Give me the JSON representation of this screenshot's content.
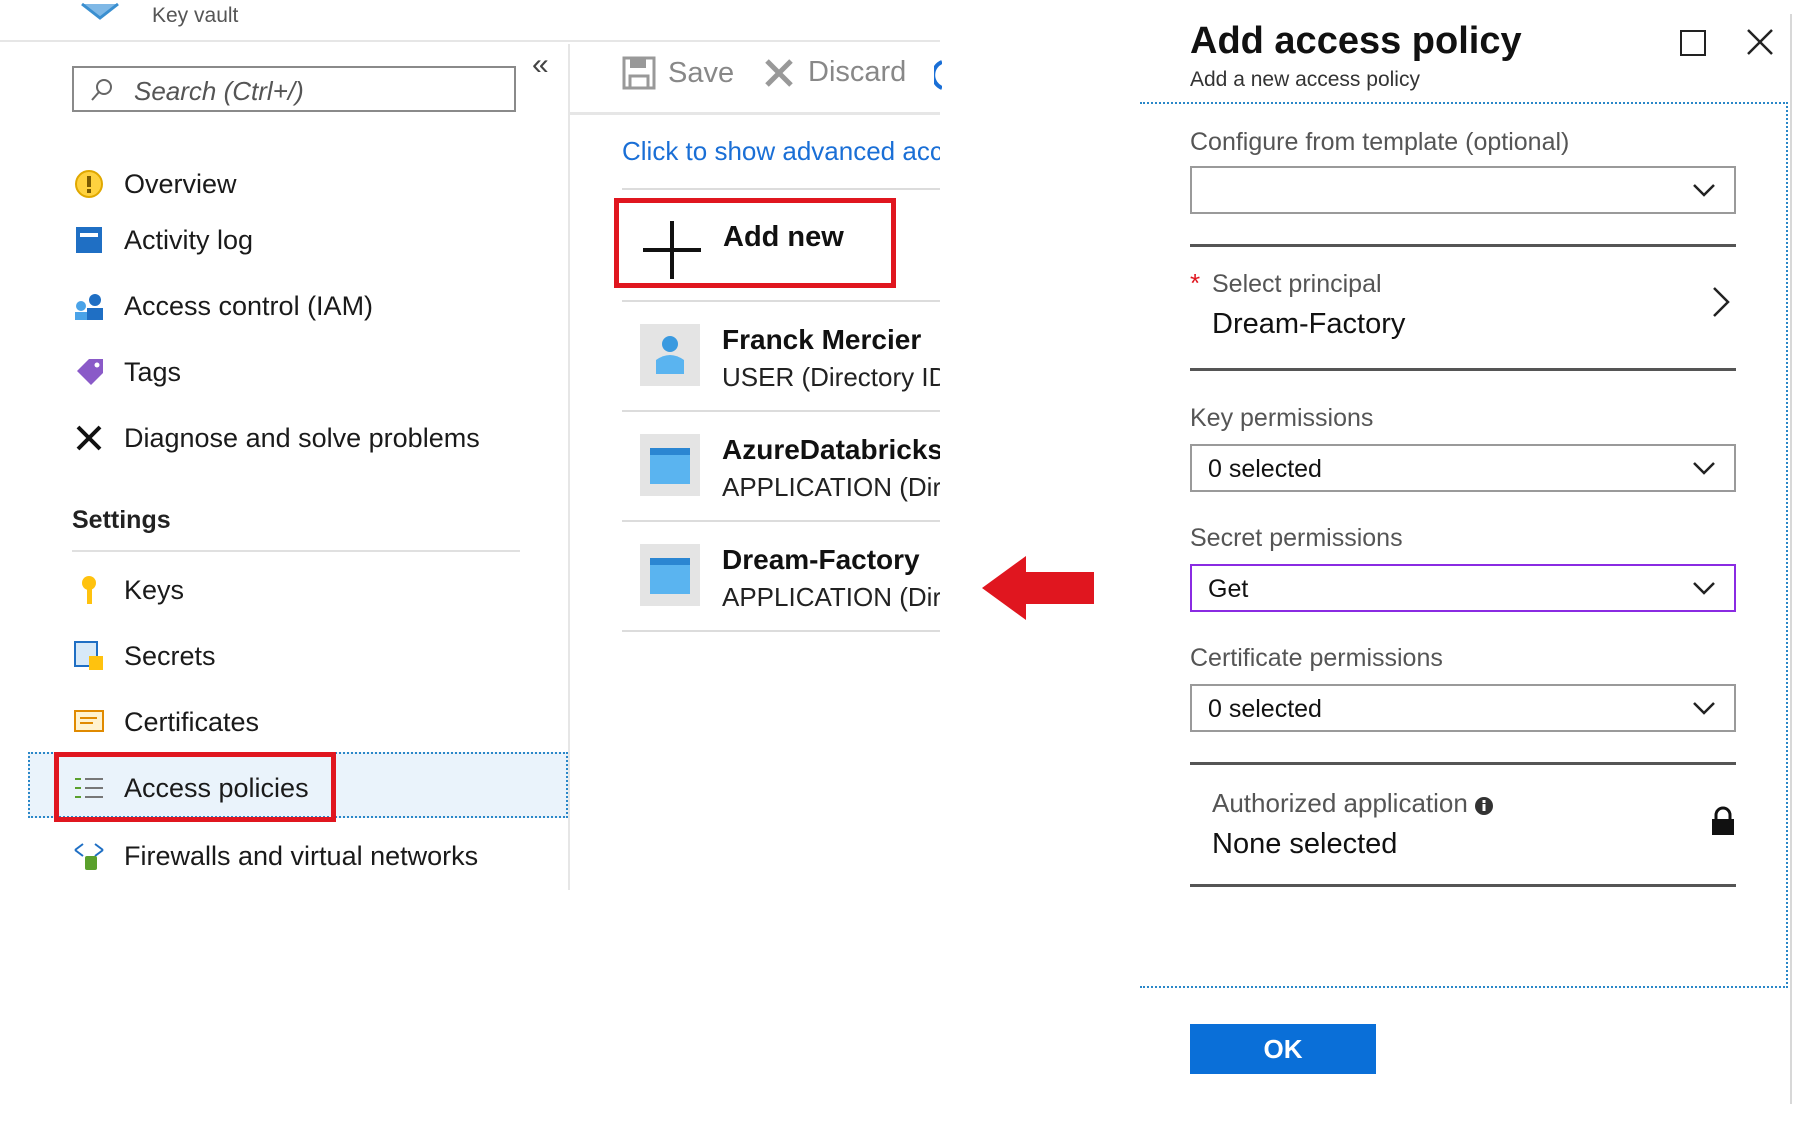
{
  "app": {
    "breadcrumb_label": "Key vault"
  },
  "sidebar": {
    "search_placeholder": "Search (Ctrl+/)",
    "collapse_glyph": "«",
    "items": [
      {
        "label": "Overview",
        "icon": "overview-icon"
      },
      {
        "label": "Activity log",
        "icon": "activity-log-icon"
      },
      {
        "label": "Access control (IAM)",
        "icon": "iam-icon"
      },
      {
        "label": "Tags",
        "icon": "tag-icon"
      },
      {
        "label": "Diagnose and solve problems",
        "icon": "wrench-icon"
      }
    ],
    "settings_heading": "Settings",
    "settings_items": [
      {
        "label": "Keys",
        "icon": "key-icon"
      },
      {
        "label": "Secrets",
        "icon": "secrets-icon"
      },
      {
        "label": "Certificates",
        "icon": "certificate-icon"
      },
      {
        "label": "Access policies",
        "icon": "list-icon",
        "selected": true
      },
      {
        "label": "Firewalls and virtual networks",
        "icon": "firewall-icon"
      }
    ]
  },
  "middle": {
    "toolbar": {
      "save_label": "Save",
      "discard_label": "Discard"
    },
    "advanced_link": "Click to show advanced access policies",
    "add_new_label": "Add new",
    "principals": [
      {
        "name": "Franck Mercier",
        "type": "USER (Directory ID:",
        "icon": "user-icon"
      },
      {
        "name": "AzureDatabricks",
        "type": "APPLICATION (Directory ID:",
        "icon": "app-icon"
      },
      {
        "name": "Dream-Factory",
        "type": "APPLICATION (Directory ID:",
        "icon": "app-icon"
      }
    ]
  },
  "panel": {
    "title": "Add access policy",
    "subtitle": "Add a new access policy",
    "template_label": "Configure from template (optional)",
    "template_value": "",
    "principal_label": "Select principal",
    "principal_value": "Dream-Factory",
    "required_marker": "*",
    "key_perm_label": "Key permissions",
    "key_perm_value": "0 selected",
    "secret_perm_label": "Secret permissions",
    "secret_perm_value": "Get",
    "cert_perm_label": "Certificate permissions",
    "cert_perm_value": "0 selected",
    "auth_app_label": "Authorized application",
    "auth_app_value": "None selected",
    "ok_label": "OK"
  },
  "colors": {
    "accent_blue": "#0a6fd8",
    "link_blue": "#1a6fd6",
    "highlight_red": "#e0161f",
    "focus_purple": "#8a2be2"
  }
}
